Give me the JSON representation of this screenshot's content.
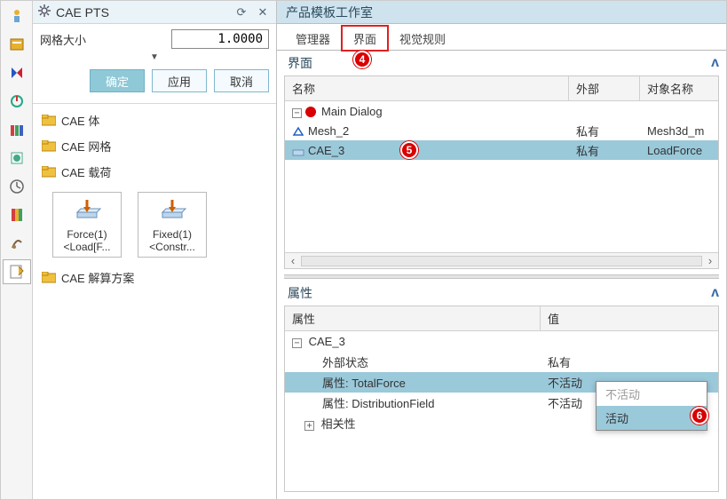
{
  "left_panel": {
    "title": "CAE PTS",
    "mesh_size_label": "网格大小",
    "mesh_size_value": "1.0000",
    "buttons": {
      "ok": "确定",
      "apply": "应用",
      "cancel": "取消"
    },
    "folders": {
      "body": "CAE 体",
      "mesh": "CAE 网格",
      "load": "CAE 载荷",
      "solution": "CAE 解算方案"
    },
    "items": {
      "force": {
        "line1": "Force(1)",
        "line2": "<Load[F..."
      },
      "fixed": {
        "line1": "Fixed(1)",
        "line2": "<Constr..."
      }
    }
  },
  "right_panel": {
    "title": "产品模板工作室",
    "tabs": {
      "manager": "管理器",
      "interface": "界面",
      "visual": "视觉规则"
    },
    "badges": {
      "tab": "4",
      "row": "5",
      "menu": "6"
    },
    "section_interface": "界面",
    "collapse_glyph": "ʌ",
    "table": {
      "headers": {
        "name": "名称",
        "external": "外部",
        "object": "对象名称"
      },
      "rows": {
        "main": "Main Dialog",
        "mesh": {
          "name": "Mesh_2",
          "ext": "私有",
          "obj": "Mesh3d_m"
        },
        "cae": {
          "name": "CAE_3",
          "ext": "私有",
          "obj": "LoadForce"
        }
      }
    },
    "section_props": "属性",
    "props": {
      "headers": {
        "name": "属性",
        "value": "值"
      },
      "group": "CAE_3",
      "ext_state": {
        "name": "外部状态",
        "value": "私有"
      },
      "total_force": {
        "name": "属性: TotalForce",
        "value": "不活动"
      },
      "dist_field": {
        "name": "属性: DistributionField",
        "value": "不活动"
      },
      "correlation": "相关性"
    },
    "dropdown": {
      "inactive": "不活动",
      "active": "活动"
    }
  },
  "icons": {
    "gear": "gear-icon",
    "refresh": "refresh-icon",
    "close": "close-icon",
    "folder": "folder-icon",
    "arrow_down": "chevron-down-icon"
  }
}
